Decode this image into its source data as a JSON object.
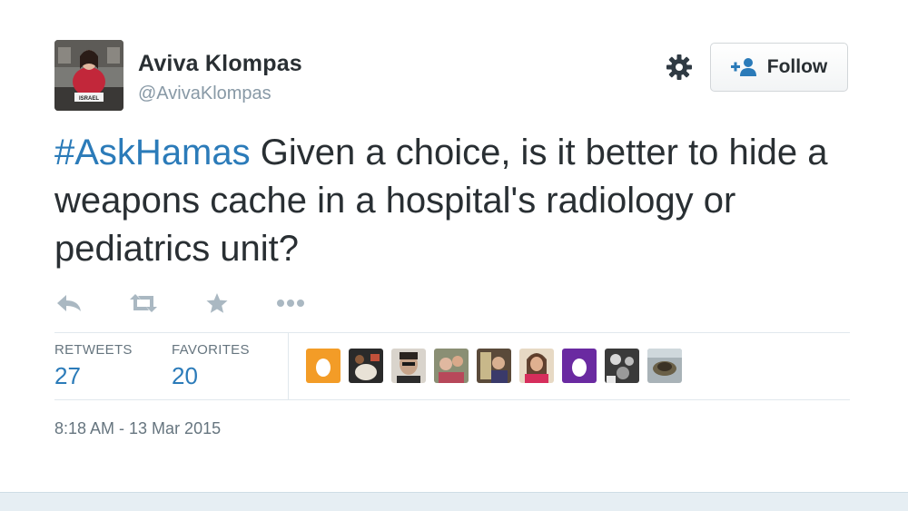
{
  "user": {
    "display_name": "Aviva Klompas",
    "handle": "@AvivaKlompas",
    "avatar_banner": "ISRAEL"
  },
  "follow_button": {
    "label": "Follow",
    "icon": "person-plus-icon"
  },
  "settings_icon": "gear-icon",
  "tweet": {
    "hashtag": "#AskHamas",
    "text": " Given a choice, is it better to hide a weapons cache in a hospital's radiology or pediatrics unit?"
  },
  "actions": [
    "reply-icon",
    "retweet-icon",
    "favorite-icon",
    "more-icon"
  ],
  "stats": {
    "retweets_label": "RETWEETS",
    "retweets_count": "27",
    "favorites_label": "FAVORITES",
    "favorites_count": "20"
  },
  "timestamp": "8:18 AM - 13 Mar 2015",
  "colors": {
    "link": "#2b7bb9",
    "text": "#292f33",
    "muted": "#8899a6",
    "egg_orange": "#f39c27",
    "egg_purple": "#6a2aa1"
  }
}
